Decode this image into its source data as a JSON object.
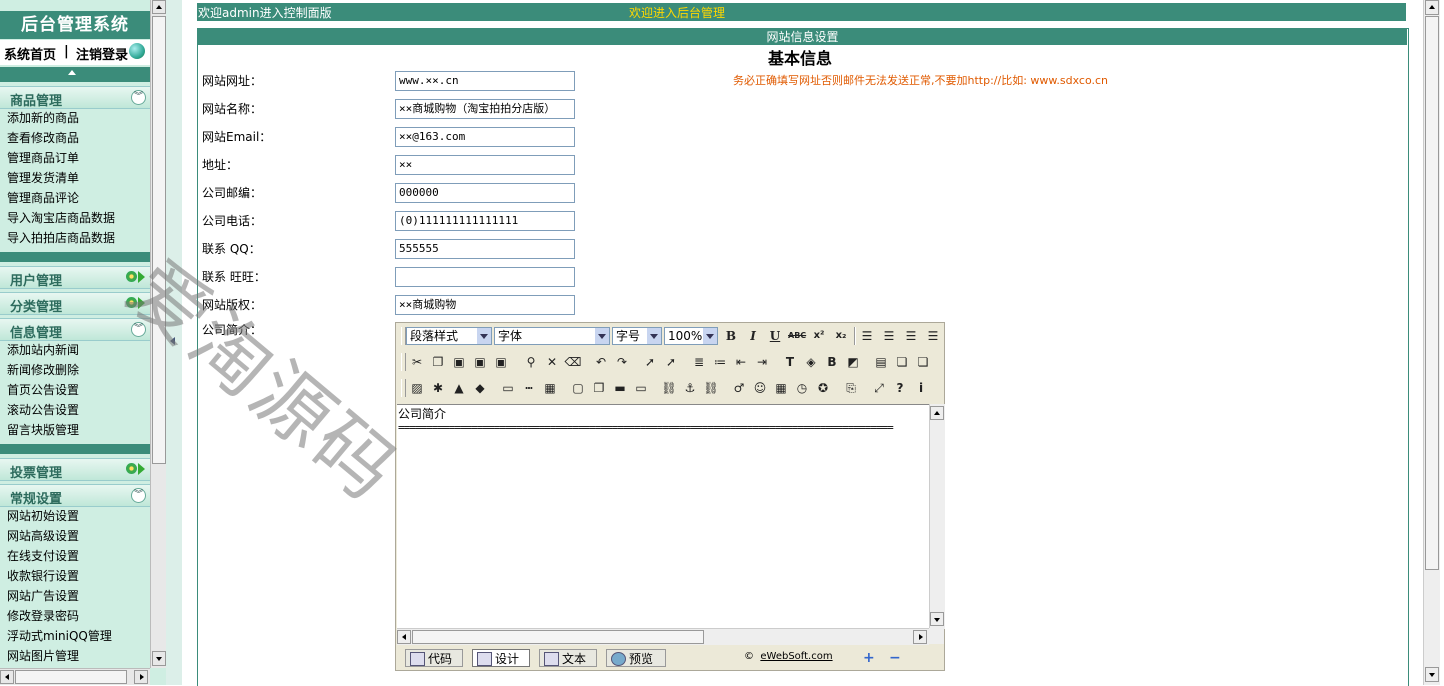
{
  "sidebar": {
    "title": "后台管理系统",
    "home_link": "系统首页",
    "separator": "|",
    "logout_link": "注销登录",
    "sections": [
      {
        "label": "商品管理",
        "items": [
          "添加新的商品",
          "查看修改商品",
          "管理商品订单",
          "管理发货清单",
          "管理商品评论",
          "导入淘宝店商品数据",
          "导入拍拍店商品数据"
        ]
      },
      {
        "label": "用户管理",
        "items": []
      },
      {
        "label": "分类管理",
        "items": []
      },
      {
        "label": "信息管理",
        "items": [
          "添加站内新闻",
          "新闻修改删除",
          "首页公告设置",
          "滚动公告设置",
          "留言块版管理"
        ]
      },
      {
        "label": "投票管理",
        "items": []
      },
      {
        "label": "常规设置",
        "items": [
          "网站初始设置",
          "网站高级设置",
          "在线支付设置",
          "收款银行设置",
          "网站广告设置",
          "修改登录密码",
          "浮动式miniQQ管理",
          "网站图片管理"
        ]
      }
    ]
  },
  "header": {
    "welcome_left": "欢迎admin进入控制面版",
    "welcome_center": "欢迎进入后台管理"
  },
  "panel": {
    "title": "网站信息设置",
    "section_title": "基本信息",
    "url_note": "务必正确填写网址否则邮件无法发送正常,不要加http://比如: www.sdxco.cn"
  },
  "form": {
    "fields": [
      {
        "label": "网站网址：",
        "value": "www.××.cn"
      },
      {
        "label": "网站名称：",
        "value": "××商城购物（淘宝拍拍分店版）"
      },
      {
        "label": "网站Email：",
        "value": "××@163.com"
      },
      {
        "label": "地址：",
        "value": "××"
      },
      {
        "label": "公司邮编：",
        "value": "000000"
      },
      {
        "label": "公司电话：",
        "value": "(0)111111111111111"
      },
      {
        "label": "联系 QQ：",
        "value": "555555"
      },
      {
        "label": "联系 旺旺：",
        "value": ""
      },
      {
        "label": "网站版权：",
        "value": "××商城购物"
      }
    ],
    "intro_label": "公司简介："
  },
  "editor": {
    "paragraph_style": "段落样式",
    "font": "字体",
    "font_size": "字号",
    "zoom": "100%",
    "content_title": "公司简介",
    "content_rule": "========================================================================================",
    "tabs": [
      "代码",
      "设计",
      "文本",
      "预览"
    ],
    "credit_symbol": "©",
    "credit_text": "eWebSoft.com",
    "toolbar_row1": [
      "bold-icon",
      "italic-icon",
      "underline-icon",
      "strikethrough-icon",
      "superscript-icon",
      "subscript-icon",
      "align-left-icon",
      "align-center-icon",
      "align-right-icon",
      "align-justify-icon"
    ],
    "toolbar_row2": [
      "cut-icon",
      "copy-icon",
      "paste-icon",
      "paste-text-icon",
      "paste-word-icon",
      "find-icon",
      "delete-icon",
      "eraser-icon",
      "undo-icon",
      "redo-icon",
      "select-icon",
      "pointer-icon",
      "ordered-list-icon",
      "unordered-list-icon",
      "outdent-icon",
      "indent-icon",
      "font-color-icon",
      "bg-color-icon",
      "highlight-icon",
      "clear-format-icon",
      "table-icon",
      "layer-icon",
      "layer2-icon"
    ],
    "toolbar_row3": [
      "image-icon",
      "flash-icon",
      "media-icon",
      "object-icon",
      "iframe-icon",
      "line-icon",
      "box-icon",
      "frame-icon",
      "form-icon",
      "hr-icon",
      "input-icon",
      "link-icon",
      "anchor-icon",
      "unlink-icon",
      "special-char-icon",
      "emoticon-icon",
      "date-icon",
      "time-icon",
      "globe-icon",
      "template-icon",
      "fullscreen-icon",
      "help-icon",
      "about-icon"
    ]
  },
  "watermark": "爱淘源码",
  "colors": {
    "accent": "#3b8c7a",
    "sidebar_bg": "#cfeee2",
    "note": "#e05a00",
    "welcome_yellow": "#ffd800"
  }
}
